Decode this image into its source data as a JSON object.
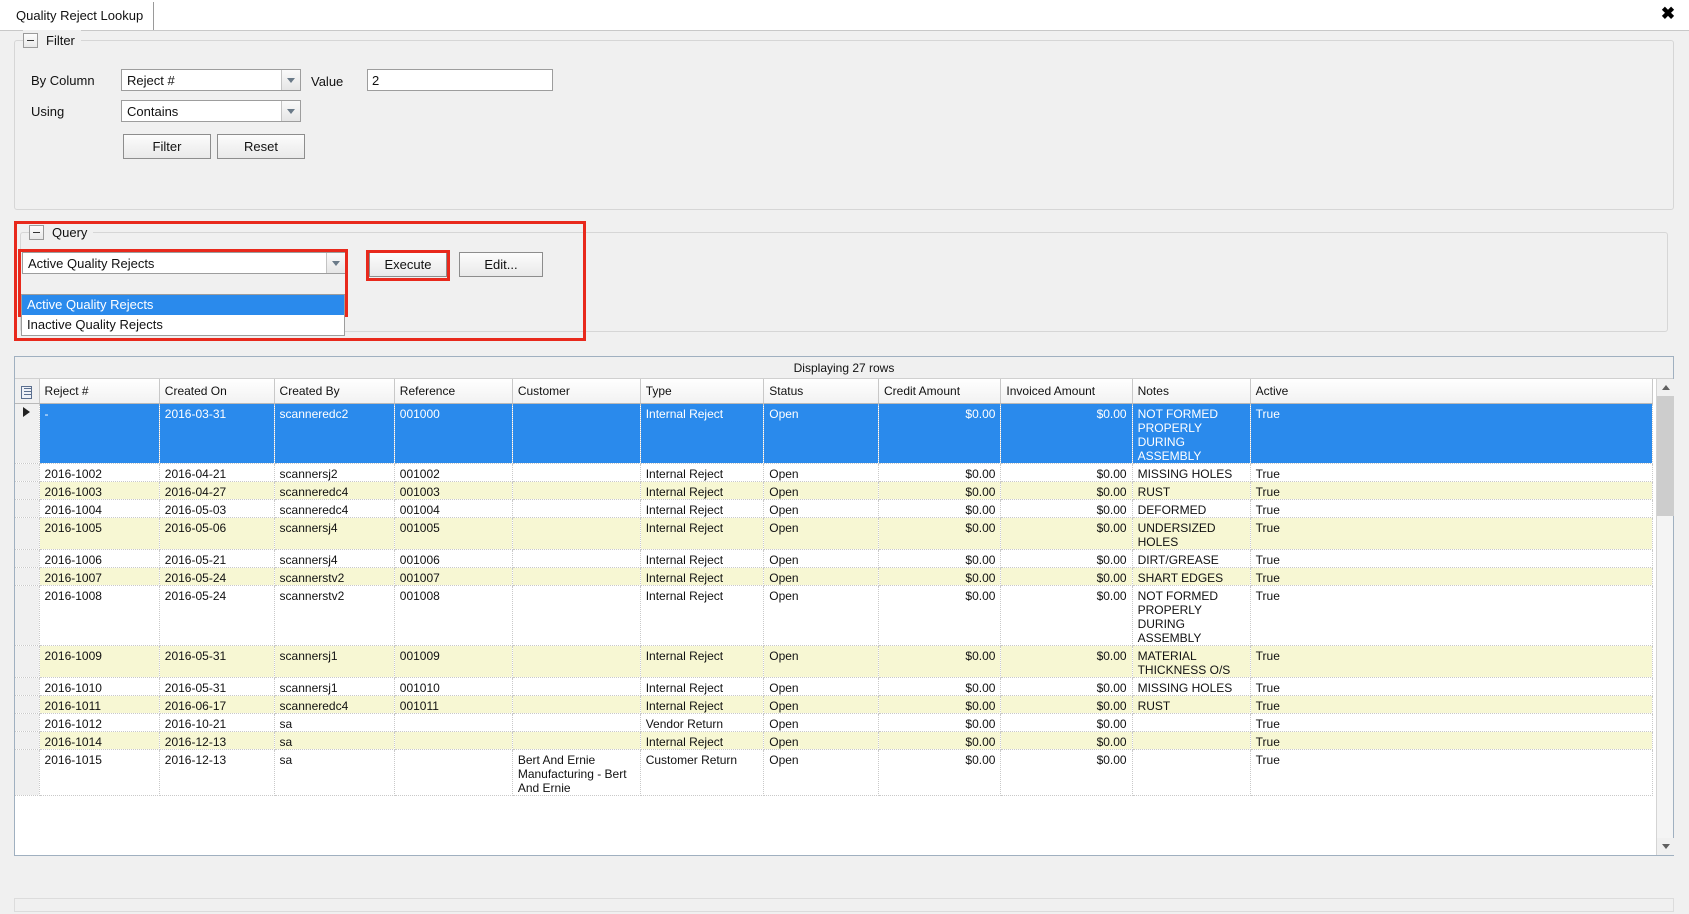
{
  "window": {
    "tab_label": "Quality Reject Lookup",
    "close_label": "✖"
  },
  "filter": {
    "group_title": "Filter",
    "by_column_label": "By Column",
    "by_column_value": "Reject #",
    "value_label": "Value",
    "value_text": "2",
    "using_label": "Using",
    "using_value": "Contains",
    "filter_button": "Filter",
    "reset_button": "Reset"
  },
  "query": {
    "group_title": "Query",
    "selected": "Active Quality Rejects",
    "options": [
      "Active Quality Rejects",
      "Inactive Quality Rejects"
    ],
    "execute_button": "Execute",
    "edit_button": "Edit...",
    "annotation_color": "#e8291c"
  },
  "grid": {
    "caption": "Displaying 27 rows",
    "columns": [
      "Reject #",
      "Created On",
      "Created By",
      "Reference",
      "Customer",
      "Type",
      "Status",
      "Credit Amount",
      "Invoiced Amount",
      "Notes",
      "Active"
    ],
    "rows": [
      {
        "reject": "-",
        "created_on": "2016-03-31",
        "created_by": "scanneredc2",
        "reference": "001000",
        "customer": "",
        "type": "Internal Reject",
        "status": "Open",
        "credit": "$0.00",
        "invoiced": "$0.00",
        "notes": "NOT FORMED PROPERLY DURING ASSEMBLY",
        "active": "True",
        "selected": true
      },
      {
        "reject": "2016-1002",
        "created_on": "2016-04-21",
        "created_by": "scannersj2",
        "reference": "001002",
        "customer": "",
        "type": "Internal Reject",
        "status": "Open",
        "credit": "$0.00",
        "invoiced": "$0.00",
        "notes": "MISSING HOLES",
        "active": "True",
        "selected": false
      },
      {
        "reject": "2016-1003",
        "created_on": "2016-04-27",
        "created_by": "scanneredc4",
        "reference": "001003",
        "customer": "",
        "type": "Internal Reject",
        "status": "Open",
        "credit": "$0.00",
        "invoiced": "$0.00",
        "notes": "RUST",
        "active": "True",
        "selected": false
      },
      {
        "reject": "2016-1004",
        "created_on": "2016-05-03",
        "created_by": "scanneredc4",
        "reference": "001004",
        "customer": "",
        "type": "Internal Reject",
        "status": "Open",
        "credit": "$0.00",
        "invoiced": "$0.00",
        "notes": "DEFORMED",
        "active": "True",
        "selected": false
      },
      {
        "reject": "2016-1005",
        "created_on": "2016-05-06",
        "created_by": "scannersj4",
        "reference": "001005",
        "customer": "",
        "type": "Internal Reject",
        "status": "Open",
        "credit": "$0.00",
        "invoiced": "$0.00",
        "notes": "UNDERSIZED HOLES",
        "active": "True",
        "selected": false
      },
      {
        "reject": "2016-1006",
        "created_on": "2016-05-21",
        "created_by": "scannersj4",
        "reference": "001006",
        "customer": "",
        "type": "Internal Reject",
        "status": "Open",
        "credit": "$0.00",
        "invoiced": "$0.00",
        "notes": "DIRT/GREASE",
        "active": "True",
        "selected": false
      },
      {
        "reject": "2016-1007",
        "created_on": "2016-05-24",
        "created_by": "scannerstv2",
        "reference": "001007",
        "customer": "",
        "type": "Internal Reject",
        "status": "Open",
        "credit": "$0.00",
        "invoiced": "$0.00",
        "notes": "SHART EDGES",
        "active": "True",
        "selected": false
      },
      {
        "reject": "2016-1008",
        "created_on": "2016-05-24",
        "created_by": "scannerstv2",
        "reference": "001008",
        "customer": "",
        "type": "Internal Reject",
        "status": "Open",
        "credit": "$0.00",
        "invoiced": "$0.00",
        "notes": "NOT FORMED PROPERLY DURING ASSEMBLY",
        "active": "True",
        "selected": false
      },
      {
        "reject": "2016-1009",
        "created_on": "2016-05-31",
        "created_by": "scannersj1",
        "reference": "001009",
        "customer": "",
        "type": "Internal Reject",
        "status": "Open",
        "credit": "$0.00",
        "invoiced": "$0.00",
        "notes": "MATERIAL THICKNESS O/S",
        "active": "True",
        "selected": false
      },
      {
        "reject": "2016-1010",
        "created_on": "2016-05-31",
        "created_by": "scannersj1",
        "reference": "001010",
        "customer": "",
        "type": "Internal Reject",
        "status": "Open",
        "credit": "$0.00",
        "invoiced": "$0.00",
        "notes": "MISSING HOLES",
        "active": "True",
        "selected": false
      },
      {
        "reject": "2016-1011",
        "created_on": "2016-06-17",
        "created_by": "scanneredc4",
        "reference": "001011",
        "customer": "",
        "type": "Internal Reject",
        "status": "Open",
        "credit": "$0.00",
        "invoiced": "$0.00",
        "notes": "RUST",
        "active": "True",
        "selected": false
      },
      {
        "reject": "2016-1012",
        "created_on": "2016-10-21",
        "created_by": "sa",
        "reference": "",
        "customer": "",
        "type": "Vendor Return",
        "status": "Open",
        "credit": "$0.00",
        "invoiced": "$0.00",
        "notes": "",
        "active": "True",
        "selected": false
      },
      {
        "reject": "2016-1014",
        "created_on": "2016-12-13",
        "created_by": "sa",
        "reference": "",
        "customer": "",
        "type": "Internal Reject",
        "status": "Open",
        "credit": "$0.00",
        "invoiced": "$0.00",
        "notes": "",
        "active": "True",
        "selected": false
      },
      {
        "reject": "2016-1015",
        "created_on": "2016-12-13",
        "created_by": "sa",
        "reference": "",
        "customer": "Bert And Ernie Manufacturing - Bert And Ernie",
        "type": "Customer Return",
        "status": "Open",
        "credit": "$0.00",
        "invoiced": "$0.00",
        "notes": "",
        "active": "True",
        "selected": false
      }
    ]
  }
}
